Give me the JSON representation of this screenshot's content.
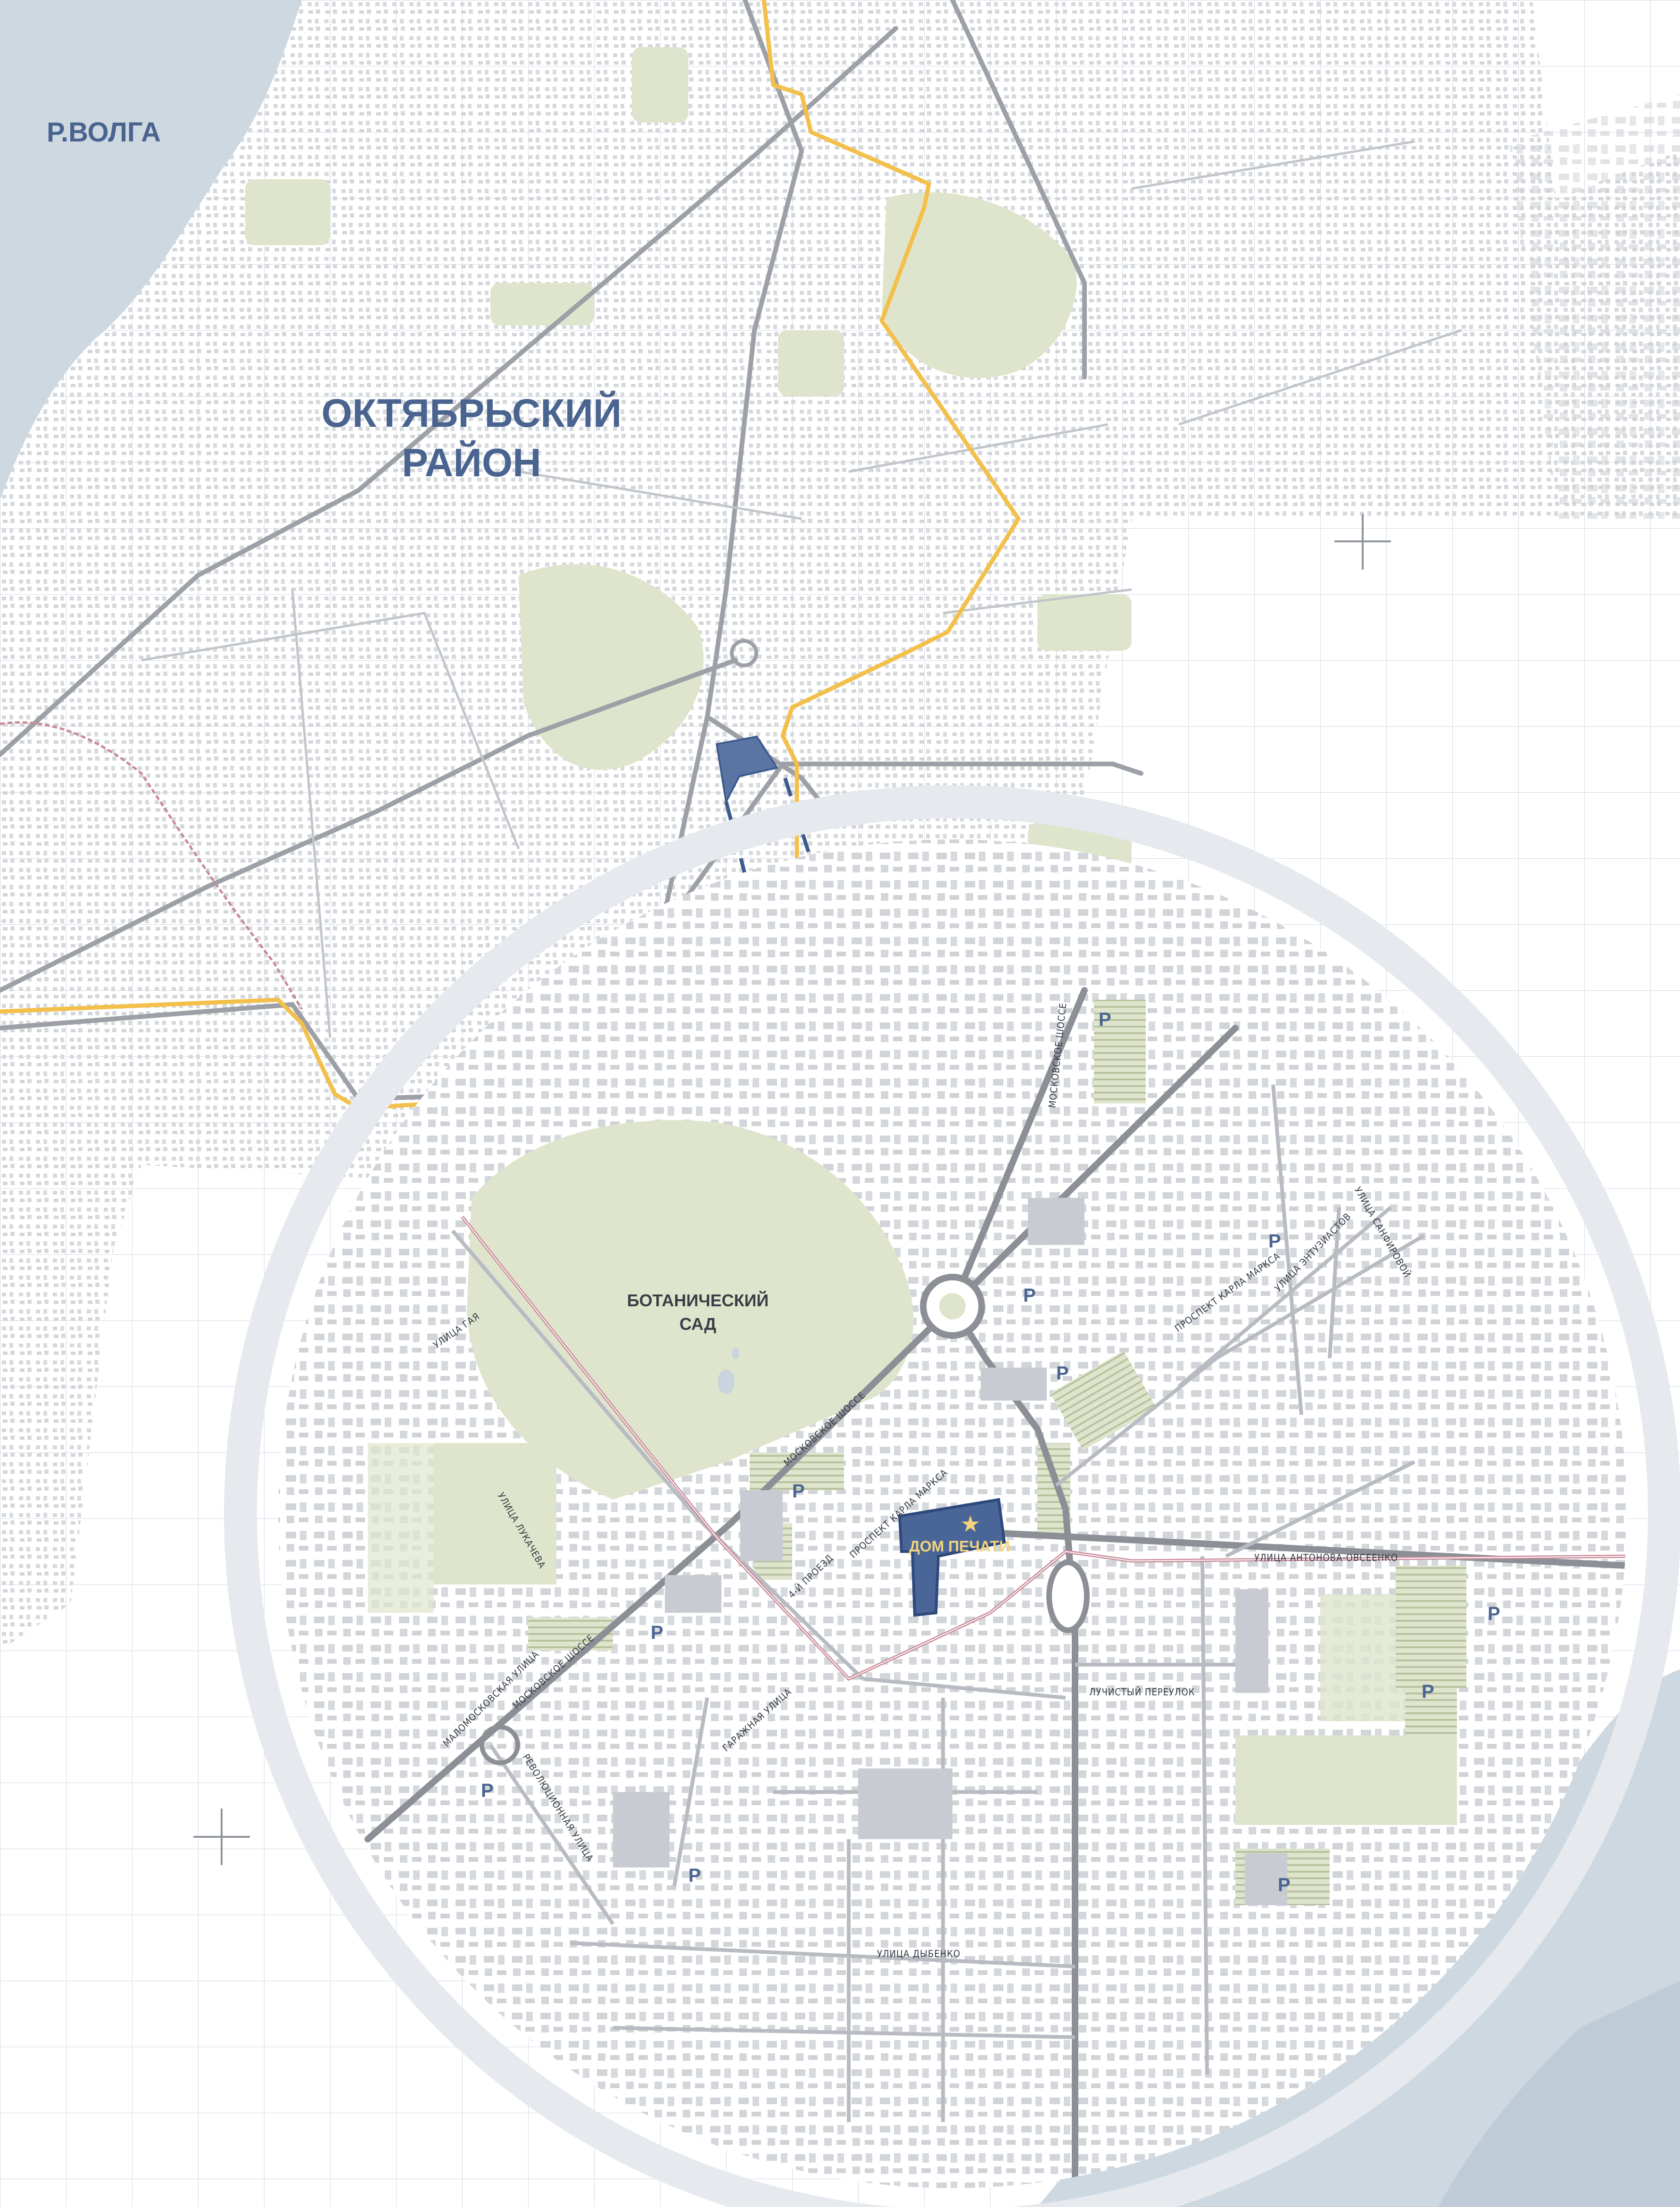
{
  "title_river": "Р.ВОЛГА",
  "district": {
    "line1": "ОКТЯБРЬСКИЙ",
    "line2": "РАЙОН"
  },
  "park": {
    "line1": "БОТАНИЧЕСКИЙ",
    "line2": "САД"
  },
  "target_building": "ДОМ ПЕЧАТИ",
  "parking_symbol": "P",
  "streets": {
    "moskovskoe_top": "МОСКОВСКОЕ ШОССЕ",
    "moskovskoe_mid": "МОСКОВСКОЕ ШОССЕ",
    "moskovskoe_low": "МОСКОВСКОЕ ШОССЕ",
    "gaya": "УЛИЦА ГАЯ",
    "lukacheva": "УЛИЦА ЛУКАЧЕВА",
    "malomoskovskaya": "МАЛОМОСКОВСКАЯ УЛИЦА",
    "revolyutsionnaya": "РЕВОЛЮЦИОННАЯ УЛИЦА",
    "garazhnaya": "ГАРАЖНАЯ УЛИЦА",
    "proezd4": "4-Й ПРОЕЗД",
    "marksa_1": "ПРОСПЕКТ КАРЛА МАРКСА",
    "marksa_2": "ПРОСПЕКТ КАРЛА МАРКСА",
    "antonova": "УЛИЦА АНТОНОВА-ОВСЕЕНКО",
    "luchisty": "ЛУЧИСТЫЙ ПЕРЕУЛОК",
    "dybenko": "УЛИЦА ДЫБЕНКО",
    "entuziastov": "УЛИЦА ЭНТУЗИАСТОВ",
    "sanfirovoy": "УЛИЦА САНФИРОВОЙ"
  },
  "colors": {
    "water": "#c9d4de",
    "green": "#dfe5cd",
    "road": "#b8bcc2",
    "highway": "#8c9096",
    "metro_line": "#f2c04b",
    "target": "#3e5a8f",
    "rail": "#c88a98"
  },
  "icons": [
    "star-icon",
    "parking-icon",
    "crosshair-icon"
  ]
}
